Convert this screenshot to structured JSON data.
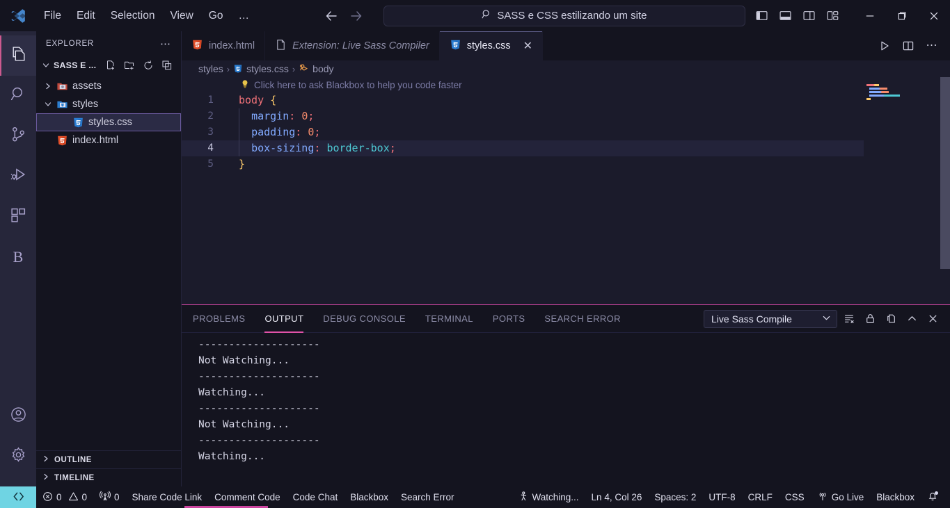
{
  "titlebar": {
    "logo_icon": "vscode-logo-icon",
    "menus": [
      "File",
      "Edit",
      "Selection",
      "View",
      "Go",
      "…"
    ],
    "back_icon": "arrow-left-icon",
    "forward_icon": "arrow-right-icon",
    "search": {
      "icon": "search-icon",
      "value": "SASS e CSS estilizando um site",
      "placeholder": "Search"
    },
    "layout_buttons": [
      {
        "name": "toggle-primary-sidebar-icon",
        "title": "Toggle Primary Side Bar"
      },
      {
        "name": "toggle-panel-icon",
        "title": "Toggle Panel"
      },
      {
        "name": "toggle-secondary-sidebar-icon",
        "title": "Toggle Secondary Side Bar"
      },
      {
        "name": "customize-layout-icon",
        "title": "Customize Layout"
      }
    ],
    "window_controls": [
      {
        "name": "minimize-icon",
        "glyph": "—"
      },
      {
        "name": "maximize-icon",
        "glyph": "❐"
      },
      {
        "name": "close-icon",
        "glyph": "✕"
      }
    ]
  },
  "activitybar": {
    "items": [
      {
        "name": "sidebar-item-explorer",
        "icon": "files-icon",
        "active": true
      },
      {
        "name": "sidebar-item-search",
        "icon": "search-icon",
        "active": false
      },
      {
        "name": "sidebar-item-source-control",
        "icon": "source-control-icon",
        "active": false
      },
      {
        "name": "sidebar-item-run-debug",
        "icon": "run-and-debug-icon",
        "active": false
      },
      {
        "name": "sidebar-item-extensions",
        "icon": "extensions-icon",
        "active": false
      },
      {
        "name": "sidebar-item-blackbox",
        "icon": "blackbox-icon",
        "label": "B",
        "active": false
      }
    ],
    "bottom": [
      {
        "name": "account-button",
        "icon": "account-icon"
      },
      {
        "name": "settings-button",
        "icon": "gear-icon"
      }
    ]
  },
  "explorer": {
    "title": "EXPLORER",
    "more_actions_icon": "ellipsis-icon",
    "root": {
      "label": "SASS E ...",
      "expanded": true,
      "actions": [
        {
          "name": "new-file-button",
          "icon": "new-file-icon"
        },
        {
          "name": "new-folder-button",
          "icon": "new-folder-icon"
        },
        {
          "name": "refresh-explorer-button",
          "icon": "refresh-icon"
        },
        {
          "name": "collapse-folders-button",
          "icon": "collapse-all-icon"
        }
      ]
    },
    "tree": [
      {
        "label": "assets",
        "type": "folder",
        "expanded": false,
        "indent": 1,
        "icon": "folder-assets-icon",
        "selected": false
      },
      {
        "label": "styles",
        "type": "folder",
        "expanded": true,
        "indent": 1,
        "icon": "folder-styles-icon",
        "selected": false
      },
      {
        "label": "styles.css",
        "type": "file",
        "indent": 2,
        "icon": "css-file-icon",
        "selected": true
      },
      {
        "label": "index.html",
        "type": "file",
        "indent": 1,
        "icon": "html-file-icon",
        "selected": false
      }
    ],
    "sections": [
      {
        "label": "OUTLINE",
        "expanded": false
      },
      {
        "label": "TIMELINE",
        "expanded": false
      }
    ]
  },
  "editor": {
    "tabs": [
      {
        "label": "index.html",
        "icon": "html-file-icon",
        "active": false,
        "preview": false
      },
      {
        "label": "Extension: Live Sass Compiler",
        "icon": "blank-file-icon",
        "active": false,
        "preview": true
      },
      {
        "label": "styles.css",
        "icon": "css-file-icon",
        "active": true,
        "preview": false,
        "close_icon": "close-icon"
      }
    ],
    "actions": [
      {
        "name": "run-code-button",
        "icon": "play-icon"
      },
      {
        "name": "split-editor-button",
        "icon": "split-editor-icon"
      },
      {
        "name": "editor-more-actions-button",
        "icon": "ellipsis-icon"
      }
    ],
    "breadcrumb": [
      {
        "label": "styles",
        "icon": null
      },
      {
        "label": "styles.css",
        "icon": "css-file-icon"
      },
      {
        "label": "body",
        "icon": "css-symbol-icon"
      }
    ],
    "codelens": {
      "icon": "lightbulb-icon",
      "text": "Click here to ask Blackbox to help you code faster"
    },
    "current_line": 4,
    "lines": [
      {
        "n": 1,
        "tokens": [
          {
            "t": "body",
            "c": "sel"
          },
          {
            "t": " ",
            "c": "plain"
          },
          {
            "t": "{",
            "c": "brace"
          }
        ]
      },
      {
        "n": 2,
        "tokens": [
          {
            "t": "  ",
            "c": "plain"
          },
          {
            "t": "margin",
            "c": "prop"
          },
          {
            "t": ":",
            "c": "punc"
          },
          {
            "t": " ",
            "c": "plain"
          },
          {
            "t": "0",
            "c": "num"
          },
          {
            "t": ";",
            "c": "punc"
          }
        ]
      },
      {
        "n": 3,
        "tokens": [
          {
            "t": "  ",
            "c": "plain"
          },
          {
            "t": "padding",
            "c": "prop"
          },
          {
            "t": ":",
            "c": "punc"
          },
          {
            "t": " ",
            "c": "plain"
          },
          {
            "t": "0",
            "c": "num"
          },
          {
            "t": ";",
            "c": "punc"
          }
        ]
      },
      {
        "n": 4,
        "tokens": [
          {
            "t": "  ",
            "c": "plain"
          },
          {
            "t": "box-sizing",
            "c": "prop"
          },
          {
            "t": ":",
            "c": "punc"
          },
          {
            "t": " ",
            "c": "plain"
          },
          {
            "t": "border-box",
            "c": "val"
          },
          {
            "t": ";",
            "c": "punc"
          }
        ]
      },
      {
        "n": 5,
        "tokens": [
          {
            "t": "}",
            "c": "brace"
          }
        ]
      }
    ]
  },
  "panel": {
    "tabs": [
      {
        "label": "PROBLEMS",
        "active": false
      },
      {
        "label": "OUTPUT",
        "active": true
      },
      {
        "label": "DEBUG CONSOLE",
        "active": false
      },
      {
        "label": "TERMINAL",
        "active": false
      },
      {
        "label": "PORTS",
        "active": false
      },
      {
        "label": "SEARCH ERROR",
        "active": false
      }
    ],
    "channel_select": {
      "value": "Live Sass Compile",
      "chevron_icon": "chevron-down-icon"
    },
    "actions": [
      {
        "name": "clear-output-button",
        "icon": "clear-output-icon"
      },
      {
        "name": "lock-scroll-button",
        "icon": "lock-icon"
      },
      {
        "name": "open-in-editor-button",
        "icon": "open-editor-icon"
      },
      {
        "name": "maximize-panel-button",
        "icon": "chevron-up-icon"
      },
      {
        "name": "close-panel-button",
        "icon": "close-icon"
      }
    ],
    "output_lines": [
      "--------------------",
      "Not Watching...",
      "--------------------",
      "Watching...",
      "--------------------",
      "Not Watching...",
      "--------------------",
      "Watching..."
    ]
  },
  "statusbar": {
    "remote_icon": "remote-window-icon",
    "left": [
      {
        "name": "problems-status",
        "icon": "error-icon",
        "label": "0",
        "icon2": "warning-icon",
        "label2": "0"
      },
      {
        "name": "ports-status",
        "icon": "radio-tower-icon",
        "label": "0"
      },
      {
        "name": "share-code-link-button",
        "label": "Share Code Link"
      },
      {
        "name": "comment-code-button",
        "label": "Comment Code"
      },
      {
        "name": "code-chat-button",
        "label": "Code Chat"
      },
      {
        "name": "blackbox-button",
        "label": "Blackbox"
      },
      {
        "name": "search-error-button",
        "label": "Search Error"
      }
    ],
    "right": [
      {
        "name": "live-sass-watching-status",
        "icon": "watch-icon",
        "label": "Watching..."
      },
      {
        "name": "cursor-position-status",
        "label": "Ln 4, Col 26"
      },
      {
        "name": "indentation-status",
        "label": "Spaces: 2"
      },
      {
        "name": "encoding-status",
        "label": "UTF-8"
      },
      {
        "name": "eol-status",
        "label": "CRLF"
      },
      {
        "name": "language-mode-status",
        "label": "CSS"
      },
      {
        "name": "go-live-button",
        "icon": "broadcast-icon",
        "label": "Go Live"
      },
      {
        "name": "blackbox-status",
        "label": "Blackbox"
      },
      {
        "name": "notifications-button",
        "icon": "bell-icon"
      }
    ]
  },
  "colors": {
    "accent_pink": "#cc45a0",
    "remote_cyan": "#6fd4e3",
    "background": "#1b1b2b",
    "activitybar": "#26263a",
    "selection_border": "#6b5a9e"
  }
}
